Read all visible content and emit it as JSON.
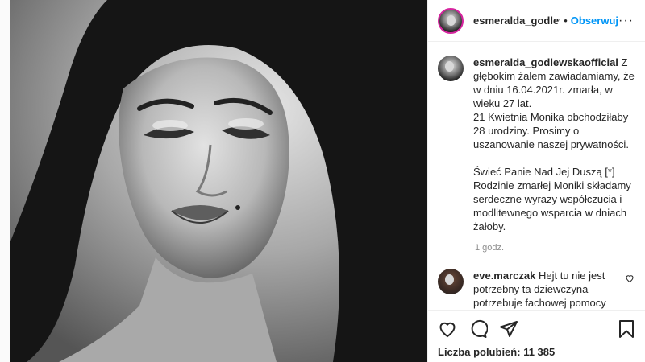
{
  "post": {
    "author": "esmeralda_godlewskac",
    "separator": "•",
    "follow_label": "Obserwuj",
    "more_label": "···",
    "caption_author": "esmeralda_godlewskaofficial",
    "caption": "Z głębokim żalem zawiadamiamy, że w dniu 16.04.2021r. zmarła, w wieku 27 lat.\n21 Kwietnia Monika obchodziłaby 28 urodziny. Prosimy o uszanowanie naszej prywatności.\n\nŚwieć Panie Nad Jej Duszą [*]\nRodzinie zmarłej Moniki składamy serdeczne wyrazy współczucia i modlitewnego wsparcia w dniach żałoby.",
    "time_ago": "1 godz."
  },
  "comments": [
    {
      "author": "eve.marczak",
      "text": "Hejt tu nie jest potrzebny ta dziewczyna potrzebuje fachowej pomocy jeśli ma takie myśli to strasznie smutne 😢 Oby to nie była prawda i ona żyje"
    }
  ],
  "actions": {
    "likes_label": "Liczba polubień:",
    "likes_count": "11 385"
  },
  "icons": [
    "heart-icon",
    "comment-icon",
    "share-icon",
    "bookmark-icon",
    "more-icon"
  ]
}
